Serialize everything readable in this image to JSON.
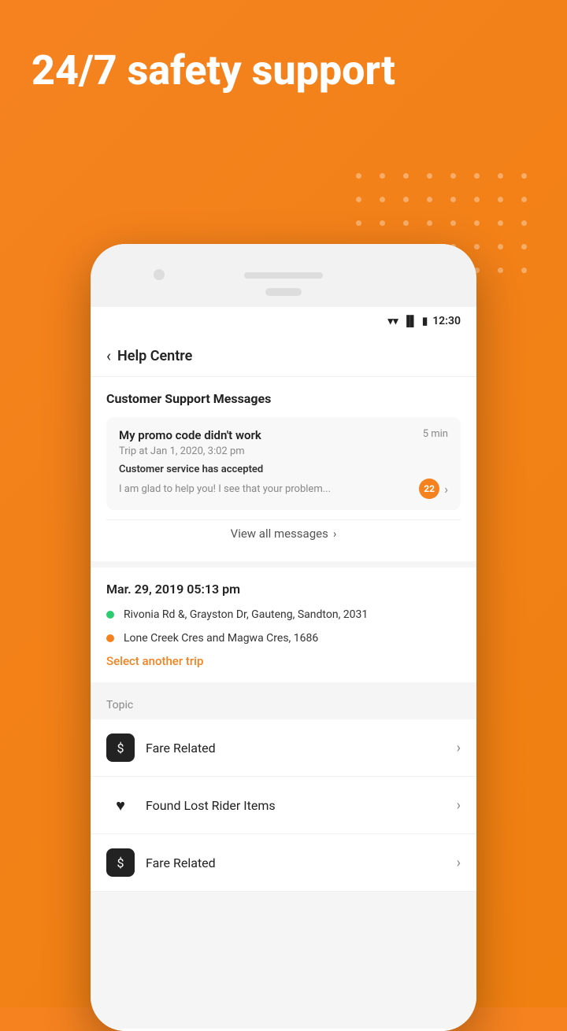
{
  "background": {
    "color": "#F5821F"
  },
  "hero": {
    "title": "24/7 safety support"
  },
  "statusBar": {
    "time": "12:30",
    "wifiIcon": "wifi",
    "signalIcon": "signal",
    "batteryIcon": "battery"
  },
  "header": {
    "backLabel": "back",
    "title": "Help Centre"
  },
  "supportSection": {
    "title": "Customer Support Messages",
    "messageCard": {
      "title": "My promo code didn't work",
      "time": "5 min",
      "trip": "Trip at Jan 1, 2020, 3:02 pm",
      "status": "Customer service has accepted",
      "preview": "I am glad to help you! I see that your problem...",
      "badgeCount": "22"
    },
    "viewAllLabel": "View all messages"
  },
  "tripSection": {
    "datetime": "Mar. 29, 2019  05:13 pm",
    "pickup": "Rivonia Rd &, Grayston Dr, Gauteng, Sandton, 2031",
    "dropoff": "Lone Creek Cres and Magwa Cres, 1686",
    "selectTripLabel": "Select another trip"
  },
  "topicSection": {
    "label": "Topic",
    "items": [
      {
        "id": "fare-related-1",
        "iconType": "dollar",
        "text": "Fare Related"
      },
      {
        "id": "found-lost",
        "iconType": "heart",
        "text": "Found Lost Rider Items"
      },
      {
        "id": "fare-related-2",
        "iconType": "dollar",
        "text": "Fare Related"
      }
    ]
  }
}
